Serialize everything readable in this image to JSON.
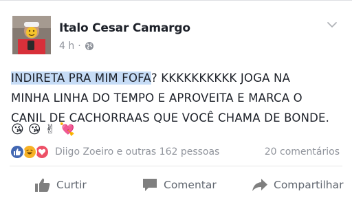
{
  "post": {
    "author": "Italo Cesar Camargo",
    "timestamp": "4 h",
    "separator": "·",
    "privacy_icon": "globe-icon",
    "text_highlighted": "INDIRETA PRA MIM FOFA",
    "text_rest_line1": "? KKKKKKKKKK JOGA NA",
    "text_line2": "MINHA LINHA DO TEMPO E APROVEITA E MARCA O",
    "text_line3": "CANIL DE CACHORRAAS QUE VOCÊ CHAMA DE BONDE.",
    "emojis": [
      "😘",
      "😘",
      "✌",
      "💘"
    ],
    "highlight_color": "#c6dcf6"
  },
  "reactions": {
    "icons": [
      "like-reaction-icon",
      "haha-reaction-icon",
      "love-reaction-icon"
    ],
    "summary": "Diigo Zoeiro e outras 162 pessoas",
    "comments": "20 comentários"
  },
  "actions": {
    "like": "Curtir",
    "comment": "Comentar",
    "share": "Compartilhar"
  },
  "colors": {
    "like_blue": "#4267b2",
    "haha_yellow": "#f7b125",
    "love_red": "#ed5167",
    "secondary_text": "#90949c",
    "action_text": "#616770"
  }
}
